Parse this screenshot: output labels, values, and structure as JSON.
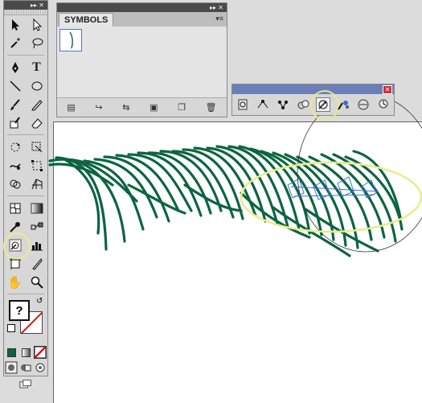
{
  "symbols_panel": {
    "tab_label": "SYMBOLS",
    "title_controls": "▸▸  ✕",
    "menu": "▾≡"
  },
  "toolbox": {
    "title_controls": "▸▸  ✕",
    "fill_indicator": "?"
  },
  "symbolism_tools": {
    "close_glyph": "✕"
  },
  "colors": {
    "brush_green": "#0c6540",
    "highlight_yellow": "#e9ec8c",
    "toolbar_title_blue": "#6a7fb8"
  }
}
